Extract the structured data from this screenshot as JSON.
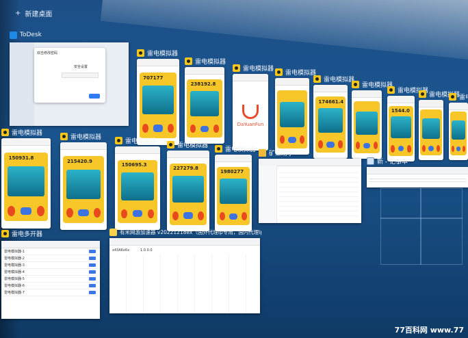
{
  "taskview": {
    "plus": "+",
    "new_desktop_label": "新建桌面"
  },
  "todesk": {
    "title": "ToDesk",
    "dialog_title": "安全设置",
    "popup_title": "双击修改密码"
  },
  "emulator_title": "雷电模拟器",
  "emulators_row1": [
    {
      "score": "707177"
    },
    {
      "score": "238192.8"
    },
    {
      "score": "",
      "splash_text": "DaYuanFun"
    },
    {
      "score": ""
    },
    {
      "score": "174661.4"
    },
    {
      "score": ""
    },
    {
      "score": "1544.0"
    },
    {
      "score": ""
    },
    {
      "score": ""
    }
  ],
  "emulators_row2": [
    {
      "score": "150931.8"
    },
    {
      "score": "215420.9"
    },
    {
      "score": "150695.3"
    },
    {
      "score": "227279.8"
    },
    {
      "score": "1980277"
    }
  ],
  "explorer": {
    "title": "矿工助手"
  },
  "notepad": {
    "title": "新 - 记事本"
  },
  "multi": {
    "title": "雷电多开器",
    "rows": [
      "雷电模拟器-1",
      "雷电模拟器-2",
      "雷电模拟器-3",
      "雷电模拟器-4",
      "雷电模拟器-5",
      "雷电模拟器-6",
      "雷电模拟器-7"
    ]
  },
  "accel": {
    "title": "有米网游加速器 v20221218ex（国外代理ip专用，国内代理ip不需用...",
    "cell": "1.0.0.0",
    "cell2": "x43A6x6x"
  },
  "watermark": "77百科网 www.77"
}
